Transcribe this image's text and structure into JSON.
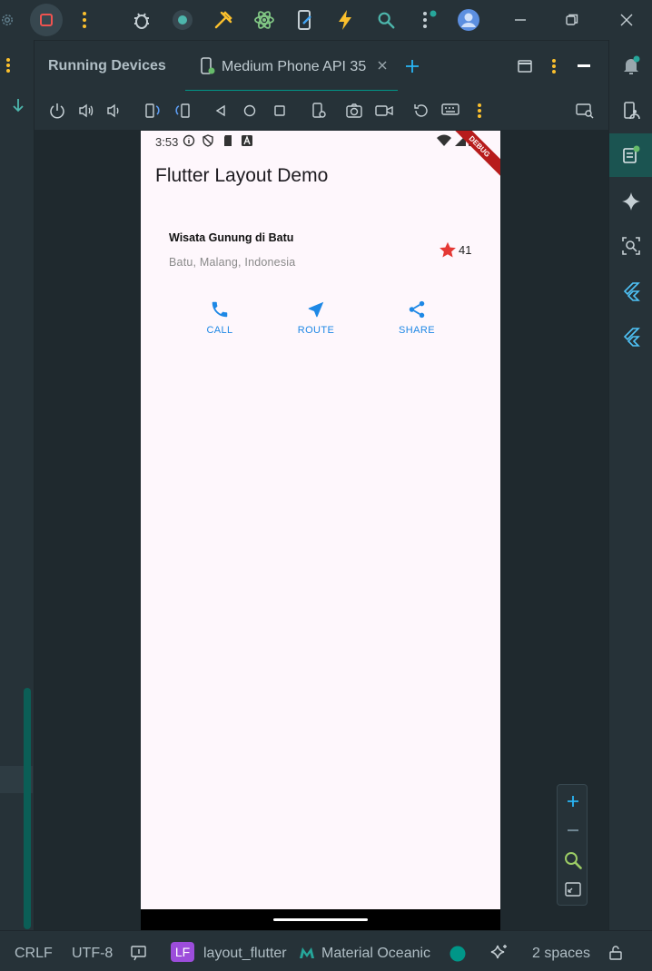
{
  "toolwindow": {
    "title": "Running Devices",
    "tab_label": "Medium Phone API 35"
  },
  "phone": {
    "status_time": "3:53",
    "debug_banner": "DEBUG",
    "app_title": "Flutter Layout Demo",
    "card": {
      "title": "Wisata Gunung di Batu",
      "subtitle": "Batu, Malang, Indonesia",
      "rating": "41"
    },
    "actions": [
      {
        "label": "CALL",
        "icon": "phone-icon"
      },
      {
        "label": "ROUTE",
        "icon": "navigation-icon"
      },
      {
        "label": "SHARE",
        "icon": "share-icon"
      }
    ]
  },
  "statusbar": {
    "line_ending": "CRLF",
    "encoding": "UTF-8",
    "project_badge": "LF",
    "project_name": "layout_flutter",
    "theme": "Material Oceanic",
    "indent": "2 spaces"
  },
  "colors": {
    "accent": "#009688",
    "phone_bg": "#fef7fc",
    "action_blue": "#1e88e5",
    "star_red": "#e53935",
    "stop_red": "#ef5350",
    "ide_bg": "#263238"
  }
}
